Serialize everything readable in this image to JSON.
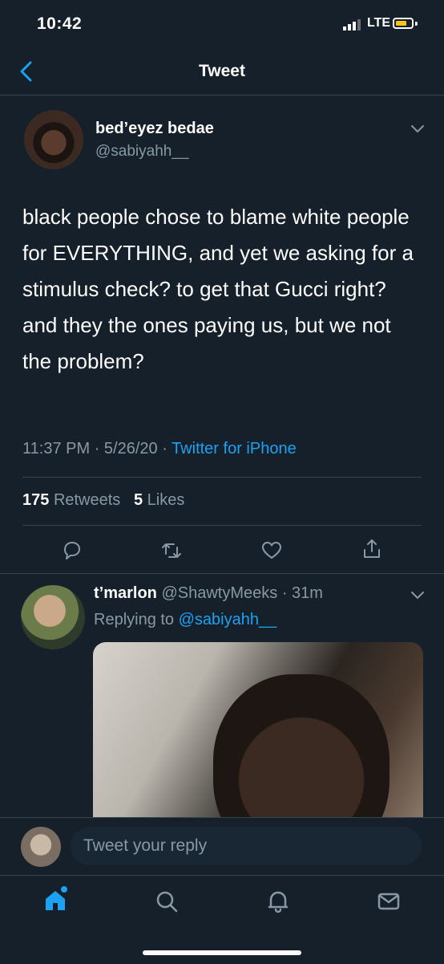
{
  "status_bar": {
    "time": "10:42",
    "network": "LTE"
  },
  "nav": {
    "title": "Tweet"
  },
  "tweet": {
    "author_name": "bed’eyez bedae",
    "author_handle": "@sabiyahh__",
    "text": "black people chose to blame white people for EVERYTHING, and yet we asking for a stimulus check? to get that Gucci right? and they the ones paying us, but we not the problem?",
    "time": "11:37 PM",
    "sep1": " · ",
    "date": "5/26/20",
    "sep2": " · ",
    "source": "Twitter for iPhone",
    "retweets_count": "175",
    "retweets_label": "Retweets",
    "likes_count": "5",
    "likes_label": "Likes"
  },
  "reply": {
    "author_name": "t’marlon",
    "author_handle": "@ShawtyMeeks",
    "sep": " · ",
    "age": "31m",
    "replying_prefix": "Replying to ",
    "replying_handle": "@sabiyahh__"
  },
  "composer": {
    "placeholder": "Tweet your reply"
  },
  "icons": {
    "back": "chevron-left-icon",
    "menu": "chevron-down-icon",
    "actions": [
      "reply-icon",
      "retweet-icon",
      "like-icon",
      "share-icon"
    ],
    "tabs": [
      "home-icon",
      "search-icon",
      "notifications-icon",
      "messages-icon"
    ]
  },
  "colors": {
    "background": "#15202b",
    "accent": "#1da1f2",
    "muted": "#8899a6",
    "divider": "#38444d"
  }
}
